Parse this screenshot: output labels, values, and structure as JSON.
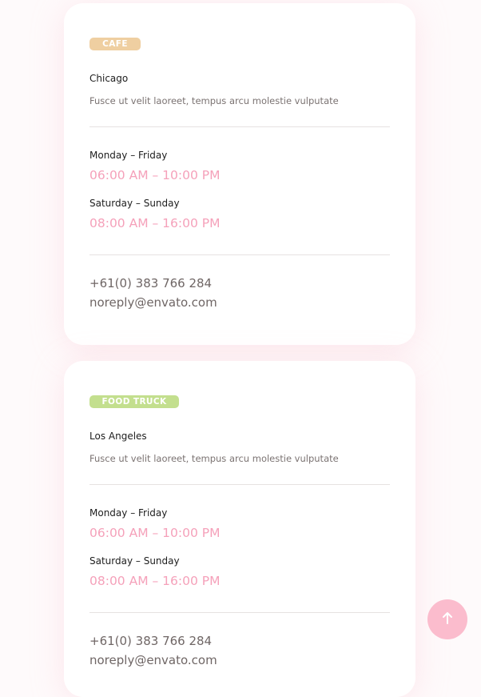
{
  "locations": [
    {
      "badge": "CAFE",
      "badge_color": "#efcfa1",
      "city": "Chicago",
      "description": "Fusce ut velit laoreet, tempus arcu molestie vulputate",
      "weekday_label": "Monday – Friday",
      "weekday_hours": "06:00 AM – 10:00 PM",
      "weekend_label": "Saturday – Sunday",
      "weekend_hours": "08:00 AM – 16:00 PM",
      "phone": "+61(0) 383 766 284",
      "email": "noreply@envato.com"
    },
    {
      "badge": "FOOD TRUCK",
      "badge_color": "#c3df8e",
      "city": "Los Angeles",
      "description": "Fusce ut velit laoreet, tempus arcu molestie vulputate",
      "weekday_label": "Monday – Friday",
      "weekday_hours": "06:00 AM – 10:00 PM",
      "weekend_label": "Saturday – Sunday",
      "weekend_hours": "08:00 AM – 16:00 PM",
      "phone": "+61(0) 383 766 284",
      "email": "noreply@envato.com"
    }
  ],
  "scroll_top": {
    "icon": "arrow-up-icon",
    "color": "#fbbccd"
  }
}
